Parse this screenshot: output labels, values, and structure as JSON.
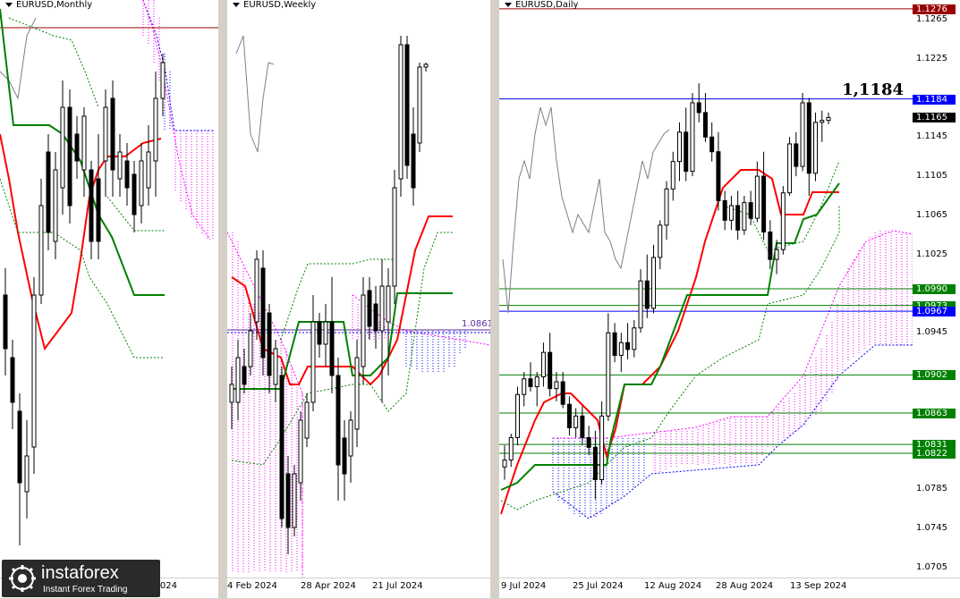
{
  "colors": {
    "tenkan": "#ff0000",
    "kijun": "#008000",
    "chikou": "#808080",
    "senkouA": "#ff00ff",
    "senkouB": "#0000ff",
    "level_red": "#990000",
    "level_green": "#008000",
    "level_blue": "#0000ff"
  },
  "chart_data": [
    {
      "type": "candlestick",
      "title": "EURUSD,Monthly",
      "x_ticks": [
        "Apr 2024"
      ]
    },
    {
      "type": "candlestick",
      "title": "EURUSD,Weekly",
      "x_ticks": [
        "4 Feb 2024",
        "28 Apr 2024",
        "21 Jul 2024"
      ],
      "annotations": [
        {
          "text": "1.0861",
          "y": 1.0861
        }
      ]
    },
    {
      "type": "candlestick",
      "title": "EURUSD,Daily",
      "ylim": [
        1.0695,
        1.1285
      ],
      "y_ticks": [
        "1.1265",
        "1.1225",
        "1.1145",
        "1.1105",
        "1.1065",
        "1.1025",
        "1.0945",
        "1.0785",
        "1.0745",
        "1.0705"
      ],
      "x_ticks": [
        "9 Jul 2024",
        "25 Jul 2024",
        "12 Aug 2024",
        "28 Aug 2024",
        "13 Sep 2024"
      ],
      "level_tags": [
        {
          "text": "1.1276",
          "y": 1.1276,
          "color": "#990000"
        },
        {
          "text": "1.1184",
          "y": 1.1184,
          "color": "#0000ff"
        },
        {
          "text": "1.1165",
          "y": 1.1165,
          "color": "#000000"
        },
        {
          "text": "1.0990",
          "y": 1.099,
          "color": "#008000"
        },
        {
          "text": "1.0973",
          "y": 1.0973,
          "color": "#008000"
        },
        {
          "text": "1.0967",
          "y": 1.0967,
          "color": "#0000ff"
        },
        {
          "text": "1.0902",
          "y": 1.0902,
          "color": "#008000"
        },
        {
          "text": "1.0863",
          "y": 1.0863,
          "color": "#008000"
        },
        {
          "text": "1.0831",
          "y": 1.0831,
          "color": "#008000"
        },
        {
          "text": "1.0822",
          "y": 1.0822,
          "color": "#008000"
        }
      ],
      "highlight_label": "1,1184",
      "candles": [
        {
          "o": 1.0808,
          "h": 1.083,
          "l": 1.0795,
          "c": 1.0815
        },
        {
          "o": 1.0815,
          "h": 1.0842,
          "l": 1.0808,
          "c": 1.0838
        },
        {
          "o": 1.0838,
          "h": 1.089,
          "l": 1.083,
          "c": 1.0882
        },
        {
          "o": 1.0882,
          "h": 1.0905,
          "l": 1.087,
          "c": 1.0898
        },
        {
          "o": 1.0898,
          "h": 1.0915,
          "l": 1.0885,
          "c": 1.089
        },
        {
          "o": 1.089,
          "h": 1.0905,
          "l": 1.087,
          "c": 1.09
        },
        {
          "o": 1.09,
          "h": 1.0935,
          "l": 1.089,
          "c": 1.0925
        },
        {
          "o": 1.0925,
          "h": 1.0945,
          "l": 1.088,
          "c": 1.0888
        },
        {
          "o": 1.0888,
          "h": 1.0905,
          "l": 1.0875,
          "c": 1.0895
        },
        {
          "o": 1.0895,
          "h": 1.0905,
          "l": 1.0868,
          "c": 1.0872
        },
        {
          "o": 1.0872,
          "h": 1.088,
          "l": 1.084,
          "c": 1.0848
        },
        {
          "o": 1.0848,
          "h": 1.0868,
          "l": 1.0838,
          "c": 1.086
        },
        {
          "o": 1.086,
          "h": 1.087,
          "l": 1.083,
          "c": 1.0838
        },
        {
          "o": 1.0838,
          "h": 1.085,
          "l": 1.082,
          "c": 1.0828
        },
        {
          "o": 1.0828,
          "h": 1.0845,
          "l": 1.0775,
          "c": 1.0795
        },
        {
          "o": 1.0795,
          "h": 1.0875,
          "l": 1.079,
          "c": 1.086
        },
        {
          "o": 1.086,
          "h": 1.0965,
          "l": 1.0855,
          "c": 1.0945
        },
        {
          "o": 1.0945,
          "h": 1.0955,
          "l": 1.0915,
          "c": 1.0922
        },
        {
          "o": 1.0922,
          "h": 1.0945,
          "l": 1.0905,
          "c": 1.0935
        },
        {
          "o": 1.0935,
          "h": 1.0955,
          "l": 1.0918,
          "c": 1.0928
        },
        {
          "o": 1.0928,
          "h": 1.0958,
          "l": 1.092,
          "c": 1.095
        },
        {
          "o": 1.095,
          "h": 1.101,
          "l": 1.0945,
          "c": 1.0998
        },
        {
          "o": 1.0998,
          "h": 1.1025,
          "l": 1.096,
          "c": 1.097
        },
        {
          "o": 1.097,
          "h": 1.1035,
          "l": 1.0965,
          "c": 1.1022
        },
        {
          "o": 1.1022,
          "h": 1.106,
          "l": 1.101,
          "c": 1.1055
        },
        {
          "o": 1.1055,
          "h": 1.11,
          "l": 1.104,
          "c": 1.1092
        },
        {
          "o": 1.1092,
          "h": 1.113,
          "l": 1.108,
          "c": 1.112
        },
        {
          "o": 1.112,
          "h": 1.116,
          "l": 1.11,
          "c": 1.115
        },
        {
          "o": 1.115,
          "h": 1.1175,
          "l": 1.11,
          "c": 1.111
        },
        {
          "o": 1.111,
          "h": 1.119,
          "l": 1.1105,
          "c": 1.118
        },
        {
          "o": 1.118,
          "h": 1.12,
          "l": 1.116,
          "c": 1.117
        },
        {
          "o": 1.117,
          "h": 1.119,
          "l": 1.114,
          "c": 1.1145
        },
        {
          "o": 1.1145,
          "h": 1.116,
          "l": 1.112,
          "c": 1.113
        },
        {
          "o": 1.113,
          "h": 1.115,
          "l": 1.107,
          "c": 1.108
        },
        {
          "o": 1.108,
          "h": 1.109,
          "l": 1.105,
          "c": 1.106
        },
        {
          "o": 1.106,
          "h": 1.1085,
          "l": 1.105,
          "c": 1.1075
        },
        {
          "o": 1.1075,
          "h": 1.109,
          "l": 1.104,
          "c": 1.105
        },
        {
          "o": 1.105,
          "h": 1.1085,
          "l": 1.1045,
          "c": 1.1078
        },
        {
          "o": 1.1078,
          "h": 1.109,
          "l": 1.1055,
          "c": 1.1062
        },
        {
          "o": 1.1062,
          "h": 1.112,
          "l": 1.1058,
          "c": 1.1105
        },
        {
          "o": 1.1105,
          "h": 1.113,
          "l": 1.104,
          "c": 1.1048
        },
        {
          "o": 1.1048,
          "h": 1.106,
          "l": 1.101,
          "c": 1.102
        },
        {
          "o": 1.102,
          "h": 1.104,
          "l": 1.1005,
          "c": 1.103
        },
        {
          "o": 1.103,
          "h": 1.1095,
          "l": 1.1025,
          "c": 1.1088
        },
        {
          "o": 1.1088,
          "h": 1.1145,
          "l": 1.1085,
          "c": 1.1138
        },
        {
          "o": 1.1138,
          "h": 1.115,
          "l": 1.1105,
          "c": 1.1115
        },
        {
          "o": 1.1115,
          "h": 1.119,
          "l": 1.111,
          "c": 1.118
        },
        {
          "o": 1.118,
          "h": 1.1185,
          "l": 1.1085,
          "c": 1.1108
        },
        {
          "o": 1.1108,
          "h": 1.117,
          "l": 1.11,
          "c": 1.116
        },
        {
          "o": 1.116,
          "h": 1.1172,
          "l": 1.114,
          "c": 1.1162
        },
        {
          "o": 1.1162,
          "h": 1.117,
          "l": 1.1158,
          "c": 1.1165
        }
      ]
    }
  ],
  "logo": {
    "brand": "instaforex",
    "tagline": "Instant Forex Trading"
  }
}
